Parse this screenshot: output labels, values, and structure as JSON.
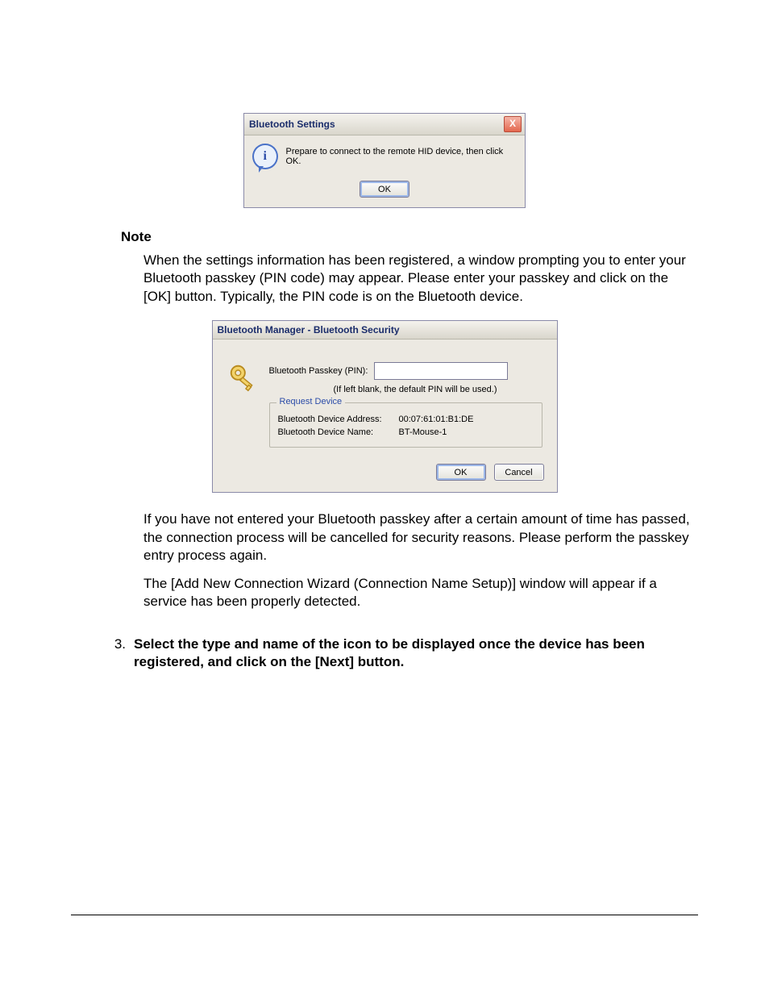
{
  "dialog1": {
    "title": "Bluetooth Settings",
    "message": "Prepare to connect to the remote HID device, then click OK.",
    "ok_label": "OK",
    "info_glyph": "i"
  },
  "note_heading": "Note",
  "paragraph1": "When the settings information has been registered, a window prompting you to enter your Bluetooth passkey (PIN code) may appear. Please enter your passkey and click on the [OK] button. Typically, the PIN code is on the Bluetooth device.",
  "dialog2": {
    "title": "Bluetooth Manager - Bluetooth Security",
    "pin_label": "Bluetooth Passkey (PIN):",
    "pin_hint": "(If left blank, the default PIN will be used.)",
    "group_title": "Request Device",
    "addr_label": "Bluetooth Device Address:",
    "addr_value": "00:07:61:01:B1:DE",
    "name_label": "Bluetooth Device Name:",
    "name_value": "BT-Mouse-1",
    "ok_label": "OK",
    "cancel_label": "Cancel"
  },
  "paragraph2": "If you have not entered your Bluetooth passkey after a certain amount of time has passed, the connection process will be cancelled for security reasons. Please perform the passkey entry process again.",
  "paragraph3": "The [Add New Connection Wizard (Connection Name Setup)] window will appear if a service has been properly detected.",
  "step3": {
    "number": "3.",
    "text": "Select the type and name of the icon to be displayed once the device has been registered, and click on the [Next] button."
  }
}
